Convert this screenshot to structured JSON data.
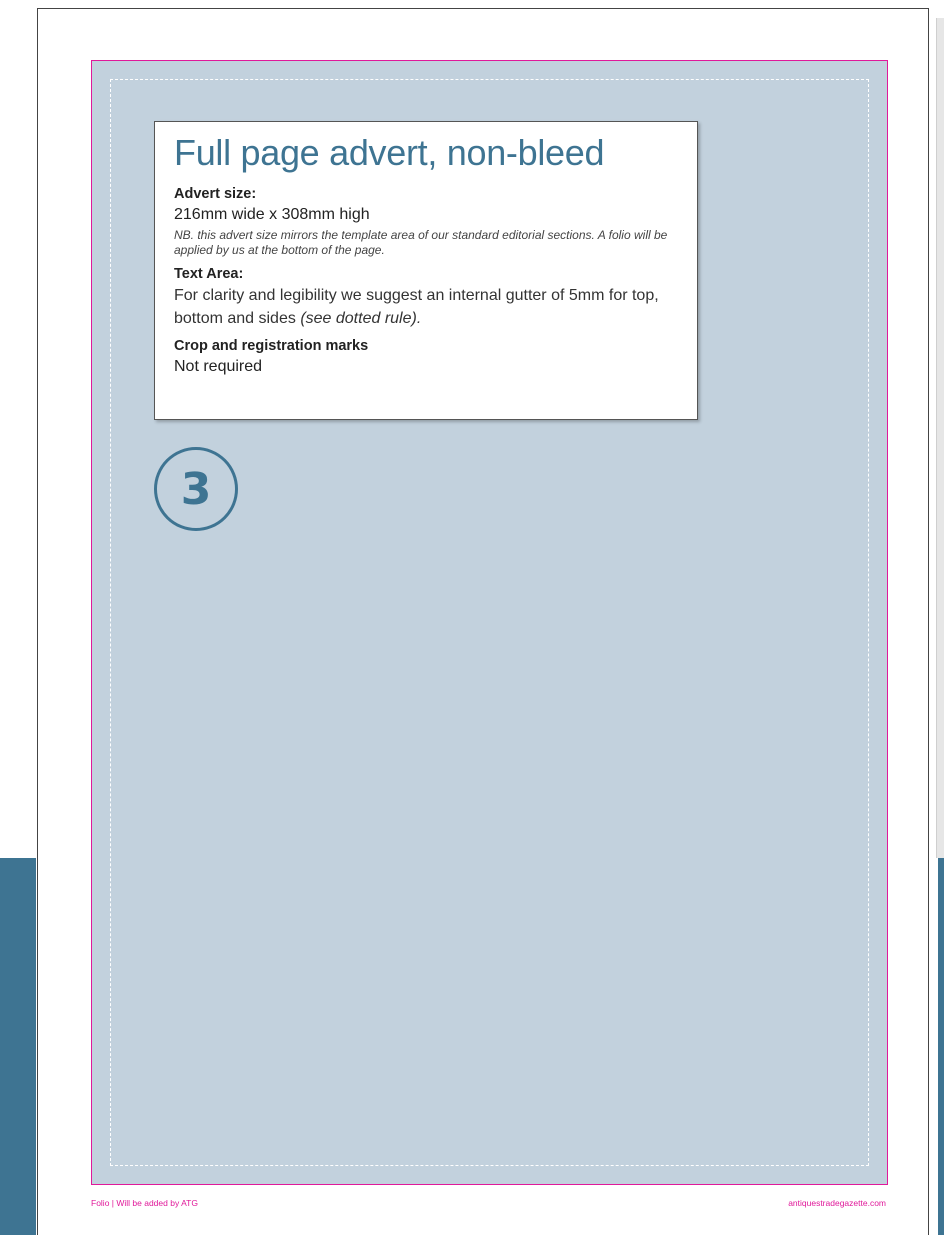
{
  "advert": {
    "title": "Full page advert, non-bleed",
    "size_label": "Advert size:",
    "size_value": "216mm wide x 308mm high",
    "size_note": "NB. this advert size mirrors the template area of our standard editorial sections. A folio will be applied by us at the bottom of the page.",
    "text_area_label": "Text Area:",
    "text_area_value": "For clarity and legibility we suggest an internal gutter of 5mm for top, bottom and sides",
    "text_area_value_italic": "(see dotted rule).",
    "crop_label": "Crop and registration marks",
    "crop_value": "Not required"
  },
  "step_number": "3",
  "folio": {
    "left": "Folio  |  Will be added by ATG",
    "right": "antiquestradegazette.com"
  },
  "colors": {
    "accent": "#3e7492",
    "advert_area": "#c2d1dd",
    "trim_line": "#e0199a"
  }
}
